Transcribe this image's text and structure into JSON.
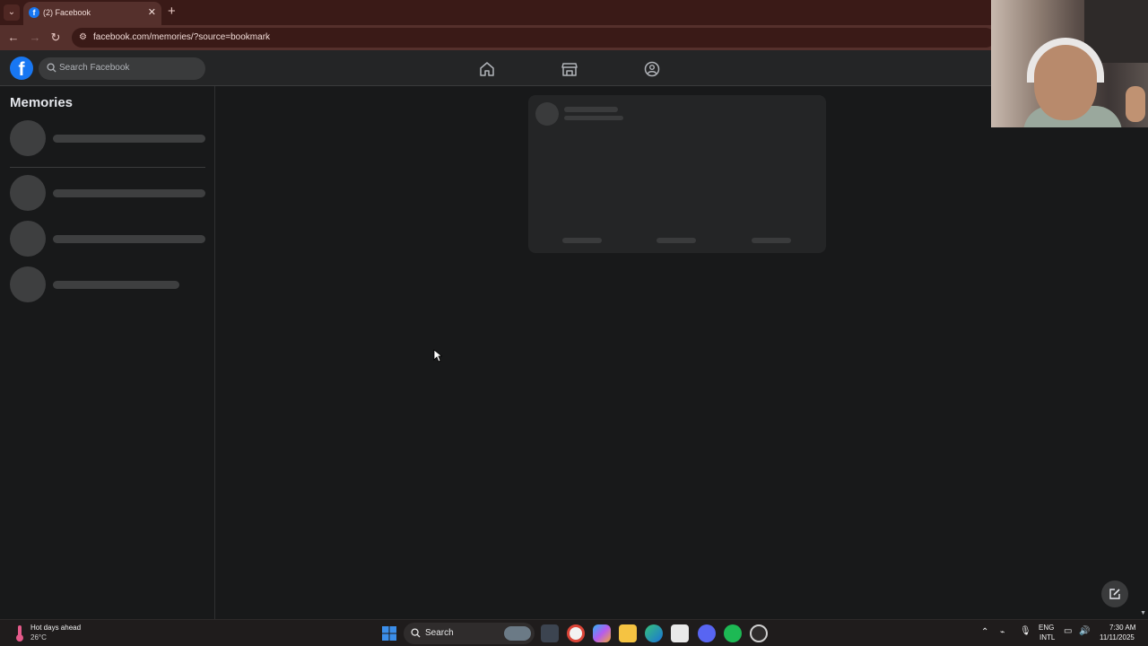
{
  "browser": {
    "tab_title": "(2) Facebook",
    "url": "facebook.com/memories/?source=bookmark",
    "close_glyph": "✕",
    "new_tab_glyph": "+"
  },
  "facebook": {
    "logo_letter": "f",
    "search_placeholder": "Search Facebook",
    "nav_icons": [
      "home-icon",
      "marketplace-icon",
      "groups-icon"
    ],
    "accent_color": "#1877f2"
  },
  "sidebar": {
    "title": "Memories",
    "skeleton_rows": 4
  },
  "taskbar": {
    "weather_title": "Hot days ahead",
    "weather_temp": "26°C",
    "search_label": "Search",
    "lang_top": "ENG",
    "lang_bottom": "INTL",
    "time": "7:30 AM",
    "date": "11/11/2025"
  }
}
